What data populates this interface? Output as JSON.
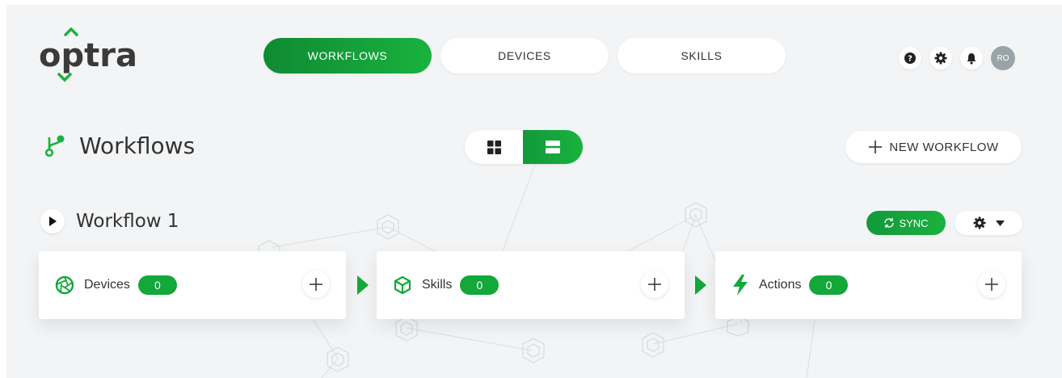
{
  "brand": {
    "logo_text": "optra"
  },
  "nav": {
    "tabs": [
      {
        "label": "WORKFLOWS",
        "active": true
      },
      {
        "label": "DEVICES",
        "active": false
      },
      {
        "label": "SKILLS",
        "active": false
      }
    ]
  },
  "header_icons": [
    "help-icon",
    "settings-gear-icon",
    "notification-bell-icon"
  ],
  "user": {
    "initials": "RO"
  },
  "page": {
    "title": "Workflows",
    "icon": "branch-icon"
  },
  "view_toggle": {
    "options": [
      "grid-view-icon",
      "list-view-icon"
    ],
    "selected": "list"
  },
  "new_workflow": {
    "label": "NEW WORKFLOW"
  },
  "workflow": {
    "name": "Workflow 1",
    "sync_label": "SYNC",
    "stages": [
      {
        "label": "Devices",
        "count": "0",
        "icon": "aperture-icon"
      },
      {
        "label": "Skills",
        "count": "0",
        "icon": "cube-icon"
      },
      {
        "label": "Actions",
        "count": "0",
        "icon": "lightning-icon"
      }
    ]
  },
  "colors": {
    "accent": "#19b23f",
    "accent_dark": "#0f8a33",
    "background": "#f3f4f5",
    "text": "#333333"
  }
}
